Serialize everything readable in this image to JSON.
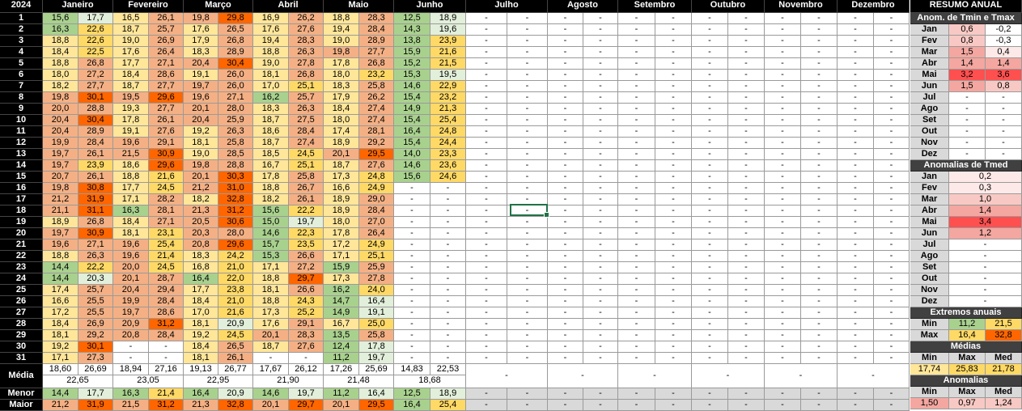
{
  "sheet": {
    "year": "2024",
    "months": [
      "Janeiro",
      "Fevereiro",
      "Março",
      "Abril",
      "Maio",
      "Junho",
      "Julho",
      "Agosto",
      "Setembro",
      "Outubro",
      "Novembro",
      "Dezembro"
    ],
    "days": [
      "1",
      "2",
      "3",
      "4",
      "5",
      "6",
      "7",
      "8",
      "9",
      "10",
      "11",
      "12",
      "13",
      "14",
      "15",
      "16",
      "17",
      "18",
      "19",
      "20",
      "21",
      "22",
      "23",
      "24",
      "25",
      "26",
      "27",
      "28",
      "29",
      "30",
      "31"
    ],
    "rows": [
      [
        [
          "15,6",
          "17,7"
        ],
        [
          "16,5",
          "26,1"
        ],
        [
          "19,8",
          "29,8"
        ],
        [
          "16,9",
          "26,2"
        ],
        [
          "18,8",
          "28,3"
        ],
        [
          "12,5",
          "18,9"
        ]
      ],
      [
        [
          "16,3",
          "22,6"
        ],
        [
          "18,7",
          "25,7"
        ],
        [
          "17,6",
          "26,5"
        ],
        [
          "17,6",
          "27,6"
        ],
        [
          "19,4",
          "28,4"
        ],
        [
          "14,3",
          "19,6"
        ]
      ],
      [
        [
          "18,8",
          "22,6"
        ],
        [
          "19,0",
          "26,9"
        ],
        [
          "17,9",
          "26,8"
        ],
        [
          "19,4",
          "28,3"
        ],
        [
          "19,0",
          "28,9"
        ],
        [
          "13,8",
          "23,9"
        ]
      ],
      [
        [
          "18,4",
          "22,5"
        ],
        [
          "17,6",
          "26,4"
        ],
        [
          "18,3",
          "28,9"
        ],
        [
          "18,8",
          "26,3"
        ],
        [
          "19,8",
          "27,7"
        ],
        [
          "15,9",
          "21,6"
        ]
      ],
      [
        [
          "18,8",
          "26,8"
        ],
        [
          "17,7",
          "27,1"
        ],
        [
          "20,4",
          "30,4"
        ],
        [
          "19,0",
          "27,8"
        ],
        [
          "17,8",
          "26,8"
        ],
        [
          "15,2",
          "21,5"
        ]
      ],
      [
        [
          "18,0",
          "27,2"
        ],
        [
          "18,4",
          "28,6"
        ],
        [
          "19,1",
          "26,0"
        ],
        [
          "18,1",
          "26,8"
        ],
        [
          "18,0",
          "23,2"
        ],
        [
          "15,3",
          "19,5"
        ]
      ],
      [
        [
          "18,2",
          "27,7"
        ],
        [
          "18,7",
          "27,7"
        ],
        [
          "19,7",
          "26,0"
        ],
        [
          "17,0",
          "25,1"
        ],
        [
          "18,3",
          "25,8"
        ],
        [
          "14,6",
          "22,9"
        ]
      ],
      [
        [
          "19,8",
          "30,1"
        ],
        [
          "19,5",
          "29,6"
        ],
        [
          "19,6",
          "27,1"
        ],
        [
          "16,2",
          "25,7"
        ],
        [
          "17,9",
          "26,2"
        ],
        [
          "15,4",
          "23,2"
        ]
      ],
      [
        [
          "20,0",
          "28,8"
        ],
        [
          "19,3",
          "27,7"
        ],
        [
          "20,1",
          "28,0"
        ],
        [
          "18,3",
          "26,3"
        ],
        [
          "18,4",
          "27,4"
        ],
        [
          "14,9",
          "21,3"
        ]
      ],
      [
        [
          "20,4",
          "30,4"
        ],
        [
          "17,8",
          "26,1"
        ],
        [
          "20,4",
          "25,9"
        ],
        [
          "18,7",
          "27,5"
        ],
        [
          "18,0",
          "27,4"
        ],
        [
          "15,4",
          "25,4"
        ]
      ],
      [
        [
          "20,4",
          "28,9"
        ],
        [
          "19,1",
          "27,6"
        ],
        [
          "19,2",
          "26,3"
        ],
        [
          "18,6",
          "28,4"
        ],
        [
          "17,4",
          "28,1"
        ],
        [
          "16,4",
          "24,8"
        ]
      ],
      [
        [
          "19,9",
          "28,4"
        ],
        [
          "19,6",
          "29,1"
        ],
        [
          "18,1",
          "25,8"
        ],
        [
          "18,7",
          "27,4"
        ],
        [
          "18,9",
          "29,2"
        ],
        [
          "15,4",
          "24,4"
        ]
      ],
      [
        [
          "19,7",
          "26,1"
        ],
        [
          "21,5",
          "30,9"
        ],
        [
          "19,0",
          "28,5"
        ],
        [
          "18,5",
          "24,5"
        ],
        [
          "20,1",
          "29,5"
        ],
        [
          "14,0",
          "23,3"
        ]
      ],
      [
        [
          "19,7",
          "23,9"
        ],
        [
          "18,6",
          "29,6"
        ],
        [
          "19,8",
          "28,8"
        ],
        [
          "16,7",
          "25,1"
        ],
        [
          "18,7",
          "27,6"
        ],
        [
          "14,6",
          "23,6"
        ]
      ],
      [
        [
          "20,7",
          "26,1"
        ],
        [
          "18,8",
          "21,6"
        ],
        [
          "20,1",
          "30,3"
        ],
        [
          "17,8",
          "25,8"
        ],
        [
          "17,3",
          "24,8"
        ],
        [
          "15,6",
          "24,6"
        ]
      ],
      [
        [
          "19,8",
          "30,8"
        ],
        [
          "17,7",
          "24,5"
        ],
        [
          "21,2",
          "31,0"
        ],
        [
          "18,8",
          "26,7"
        ],
        [
          "16,6",
          "24,9"
        ],
        [
          "-",
          "-"
        ]
      ],
      [
        [
          "21,2",
          "31,9"
        ],
        [
          "17,1",
          "28,2"
        ],
        [
          "18,2",
          "32,8"
        ],
        [
          "18,2",
          "26,1"
        ],
        [
          "18,9",
          "29,0"
        ],
        [
          "-",
          "-"
        ]
      ],
      [
        [
          "21,1",
          "31,1"
        ],
        [
          "16,3",
          "28,1"
        ],
        [
          "21,3",
          "31,2"
        ],
        [
          "15,6",
          "22,2"
        ],
        [
          "18,9",
          "28,4"
        ],
        [
          "-",
          "-"
        ]
      ],
      [
        [
          "18,9",
          "26,8"
        ],
        [
          "18,4",
          "27,1"
        ],
        [
          "20,5",
          "30,6"
        ],
        [
          "15,0",
          "19,7"
        ],
        [
          "18,0",
          "27,0"
        ],
        [
          "-",
          "-"
        ]
      ],
      [
        [
          "19,7",
          "30,9"
        ],
        [
          "18,1",
          "23,1"
        ],
        [
          "20,3",
          "28,0"
        ],
        [
          "14,6",
          "22,3"
        ],
        [
          "17,8",
          "26,4"
        ],
        [
          "-",
          "-"
        ]
      ],
      [
        [
          "19,6",
          "27,1"
        ],
        [
          "19,6",
          "25,4"
        ],
        [
          "20,8",
          "29,6"
        ],
        [
          "15,7",
          "23,5"
        ],
        [
          "17,2",
          "24,9"
        ],
        [
          "-",
          "-"
        ]
      ],
      [
        [
          "18,8",
          "26,3"
        ],
        [
          "19,6",
          "21,4"
        ],
        [
          "18,3",
          "24,2"
        ],
        [
          "15,3",
          "26,6"
        ],
        [
          "17,1",
          "25,1"
        ],
        [
          "-",
          "-"
        ]
      ],
      [
        [
          "14,4",
          "22,2"
        ],
        [
          "20,0",
          "24,5"
        ],
        [
          "16,8",
          "21,0"
        ],
        [
          "17,1",
          "27,2"
        ],
        [
          "15,9",
          "25,9"
        ],
        [
          "-",
          "-"
        ]
      ],
      [
        [
          "14,4",
          "20,3"
        ],
        [
          "20,1",
          "28,7"
        ],
        [
          "16,4",
          "22,0"
        ],
        [
          "18,8",
          "29,7"
        ],
        [
          "17,3",
          "27,8"
        ],
        [
          "-",
          "-"
        ]
      ],
      [
        [
          "17,4",
          "25,7"
        ],
        [
          "20,4",
          "29,4"
        ],
        [
          "17,7",
          "23,8"
        ],
        [
          "18,1",
          "26,6"
        ],
        [
          "16,2",
          "24,0"
        ],
        [
          "-",
          "-"
        ]
      ],
      [
        [
          "16,6",
          "25,5"
        ],
        [
          "19,9",
          "28,4"
        ],
        [
          "18,4",
          "21,0"
        ],
        [
          "18,8",
          "24,3"
        ],
        [
          "14,7",
          "16,4"
        ],
        [
          "-",
          "-"
        ]
      ],
      [
        [
          "17,2",
          "25,5"
        ],
        [
          "19,7",
          "28,6"
        ],
        [
          "17,0",
          "21,6"
        ],
        [
          "17,3",
          "25,2"
        ],
        [
          "14,9",
          "19,1"
        ],
        [
          "-",
          "-"
        ]
      ],
      [
        [
          "18,4",
          "26,9"
        ],
        [
          "20,9",
          "31,2"
        ],
        [
          "18,1",
          "20,9"
        ],
        [
          "17,6",
          "29,1"
        ],
        [
          "16,7",
          "25,0"
        ],
        [
          "-",
          "-"
        ]
      ],
      [
        [
          "18,1",
          "29,2"
        ],
        [
          "20,8",
          "28,4"
        ],
        [
          "19,2",
          "24,5"
        ],
        [
          "20,1",
          "28,3"
        ],
        [
          "13,5",
          "25,8"
        ],
        [
          "-",
          "-"
        ]
      ],
      [
        [
          "19,2",
          "30,1"
        ],
        [
          "-",
          "-"
        ],
        [
          "18,4",
          "26,5"
        ],
        [
          "18,7",
          "27,6"
        ],
        [
          "12,4",
          "17,8"
        ],
        [
          "-",
          "-"
        ]
      ],
      [
        [
          "17,1",
          "27,3"
        ],
        [
          "-",
          "-"
        ],
        [
          "18,1",
          "26,1"
        ],
        [
          "-",
          "-"
        ],
        [
          "11,2",
          "19,7"
        ],
        [
          "-",
          "-"
        ]
      ]
    ],
    "media_label": "Média",
    "media_pairs": [
      [
        "18,60",
        "26,69"
      ],
      [
        "18,94",
        "27,16"
      ],
      [
        "19,13",
        "26,77"
      ],
      [
        "17,67",
        "26,12"
      ],
      [
        "17,26",
        "25,69"
      ],
      [
        "14,83",
        "22,53"
      ]
    ],
    "media_avg": [
      "22,65",
      "23,05",
      "22,95",
      "21,90",
      "21,48",
      "18,68"
    ],
    "menor_label": "Menor",
    "menor": [
      [
        "14,4",
        "17,7"
      ],
      [
        "16,3",
        "21,4"
      ],
      [
        "16,4",
        "20,9"
      ],
      [
        "14,6",
        "19,7"
      ],
      [
        "11,2",
        "16,4"
      ],
      [
        "12,5",
        "18,9"
      ]
    ],
    "maior_label": "Maior",
    "maior": [
      [
        "21,2",
        "31,9"
      ],
      [
        "21,5",
        "31,2"
      ],
      [
        "21,3",
        "32,8"
      ],
      [
        "20,1",
        "29,7"
      ],
      [
        "20,1",
        "29,5"
      ],
      [
        "16,4",
        "25,4"
      ]
    ],
    "dash": "-"
  },
  "resumo": {
    "title": "RESUMO ANUAL",
    "anom_title": "Anom. de Tmin e Tmax",
    "months_short": [
      "Jan",
      "Fev",
      "Mar",
      "Abr",
      "Mai",
      "Jun",
      "Jul",
      "Ago",
      "Set",
      "Out",
      "Nov",
      "Dez"
    ],
    "anom_tmin": [
      "0,6",
      "0,8",
      "1,5",
      "1,4",
      "3,2",
      "1,5",
      "-",
      "-",
      "-",
      "-",
      "-",
      "-"
    ],
    "anom_tmax": [
      "-0,2",
      "-0,3",
      "0,4",
      "1,4",
      "3,6",
      "0,8",
      "-",
      "-",
      "-",
      "-",
      "-",
      "-"
    ],
    "tmed_title": "Anomalias de Tmed",
    "anom_tmed": [
      "0,2",
      "0,3",
      "1,0",
      "1,4",
      "3,4",
      "1,2",
      "-",
      "-",
      "-",
      "-",
      "-",
      "-"
    ],
    "extremos_title": "Extremos anuais",
    "min_label": "Min",
    "max_label": "Max",
    "ext_min": [
      "11,2",
      "21,5"
    ],
    "ext_max": [
      "16,4",
      "32,8"
    ],
    "medias_title": "Médias",
    "med_label": "Med",
    "medias": [
      "17,74",
      "25,83",
      "21,78"
    ],
    "anomalias_title": "Anomalias",
    "anomalias": [
      "1,50",
      "0,97",
      "1,24"
    ]
  },
  "colors": {
    "tmin_cold": "#a9d18e",
    "tmin_mid": "#ffe699",
    "tmin_hot": "#f4b084",
    "tmax_cold": "#e2efda",
    "tmax_warm": "#ffd966",
    "tmax_hot": "#f4b084",
    "tmax_extreme": "#ff6600",
    "anom_red": "#ff5050",
    "selection": "#217346"
  }
}
